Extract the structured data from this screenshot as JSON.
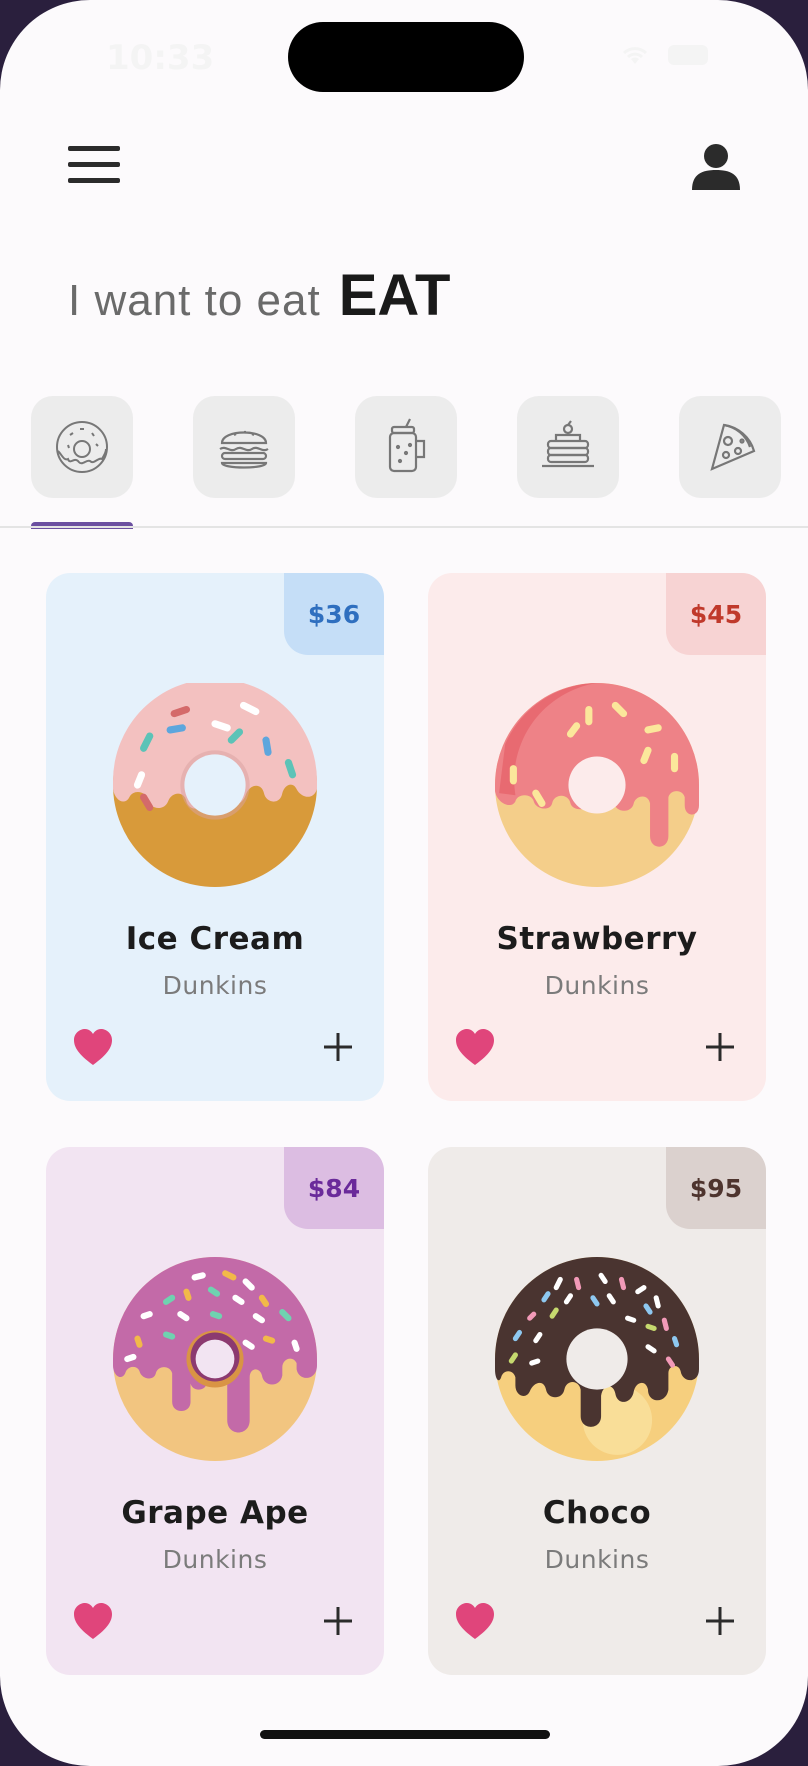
{
  "status_bar": {
    "time": "10:33"
  },
  "header": {
    "prefix": "I want to eat",
    "emphasis": "EAT"
  },
  "categories": [
    {
      "name": "donut",
      "icon": "donut-icon",
      "selected": true
    },
    {
      "name": "burger",
      "icon": "burger-icon",
      "selected": false
    },
    {
      "name": "smoothie",
      "icon": "smoothie-icon",
      "selected": false
    },
    {
      "name": "pancakes",
      "icon": "pancakes-icon",
      "selected": false
    },
    {
      "name": "pizza",
      "icon": "pizza-icon",
      "selected": false
    }
  ],
  "products": [
    {
      "name": "Ice Cream",
      "brand": "Dunkins",
      "price": "$36",
      "bg": "#e5f1fb",
      "tag_bg": "#c5def7",
      "tag_color": "#2f6fbf"
    },
    {
      "name": "Strawberry",
      "brand": "Dunkins",
      "price": "$45",
      "bg": "#fcebeb",
      "tag_bg": "#f7d3d3",
      "tag_color": "#c0392b"
    },
    {
      "name": "Grape Ape",
      "brand": "Dunkins",
      "price": "$84",
      "bg": "#f2e4f2",
      "tag_bg": "#dcbde2",
      "tag_color": "#6a2a9a"
    },
    {
      "name": "Choco",
      "brand": "Dunkins",
      "price": "$95",
      "bg": "#efebe9",
      "tag_bg": "#dbd1ce",
      "tag_color": "#4e342e"
    }
  ],
  "colors": {
    "accent": "#6b4fa0",
    "heart": "#e0457b"
  }
}
